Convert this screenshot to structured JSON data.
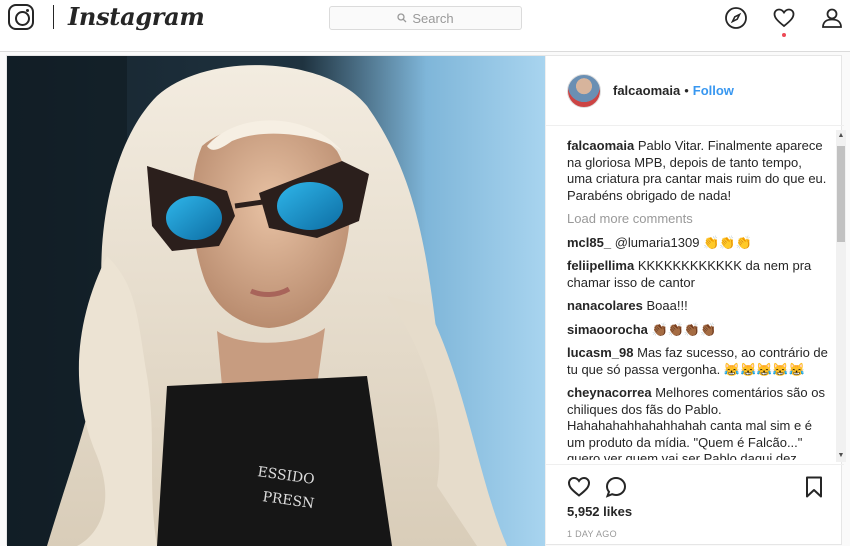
{
  "brand": {
    "wordmark": "Instagram"
  },
  "search": {
    "placeholder": "Search"
  },
  "nav": {
    "icons": [
      "compass-icon",
      "heart-icon",
      "profile-icon"
    ]
  },
  "post": {
    "username": "falcaomaia",
    "separator": "•",
    "follow_label": "Follow",
    "load_more": "Load more comments",
    "comments": [
      {
        "user": "falcaomaia",
        "text": "Pablo Vitar. Finalmente aparece na gloriosa MPB, depois de tanto tempo, uma criatura pra cantar mais ruim do que eu. Parabéns obrigado de nada!"
      },
      {
        "user": "mcl85_",
        "text": "@lumaria1309 👏👏👏"
      },
      {
        "user": "feliipellima",
        "text": "KKKKKKKKKKKK da nem pra chamar isso de cantor"
      },
      {
        "user": "nanacolares",
        "text": "Boaa!!!"
      },
      {
        "user": "simaoorocha",
        "text": "👏🏾👏🏾👏🏾👏🏾"
      },
      {
        "user": "lucasm_98",
        "text": "Mas faz sucesso, ao contrário de tu que só passa vergonha. 😹😹😹😹😹"
      },
      {
        "user": "cheynacorrea",
        "text": "Melhores comentários são os chiliques dos fãs do Pablo. Hahahahahhahahhahah canta mal sim e é um produto da mídia. \"Quem é Falcão...\" quero ver quem vai ser Pablo daqui dez"
      }
    ],
    "likes": "5,952 likes",
    "time_ago": "1 DAY AGO"
  },
  "colors": {
    "link": "#3897f0",
    "muted": "#999999",
    "text": "#262626"
  }
}
